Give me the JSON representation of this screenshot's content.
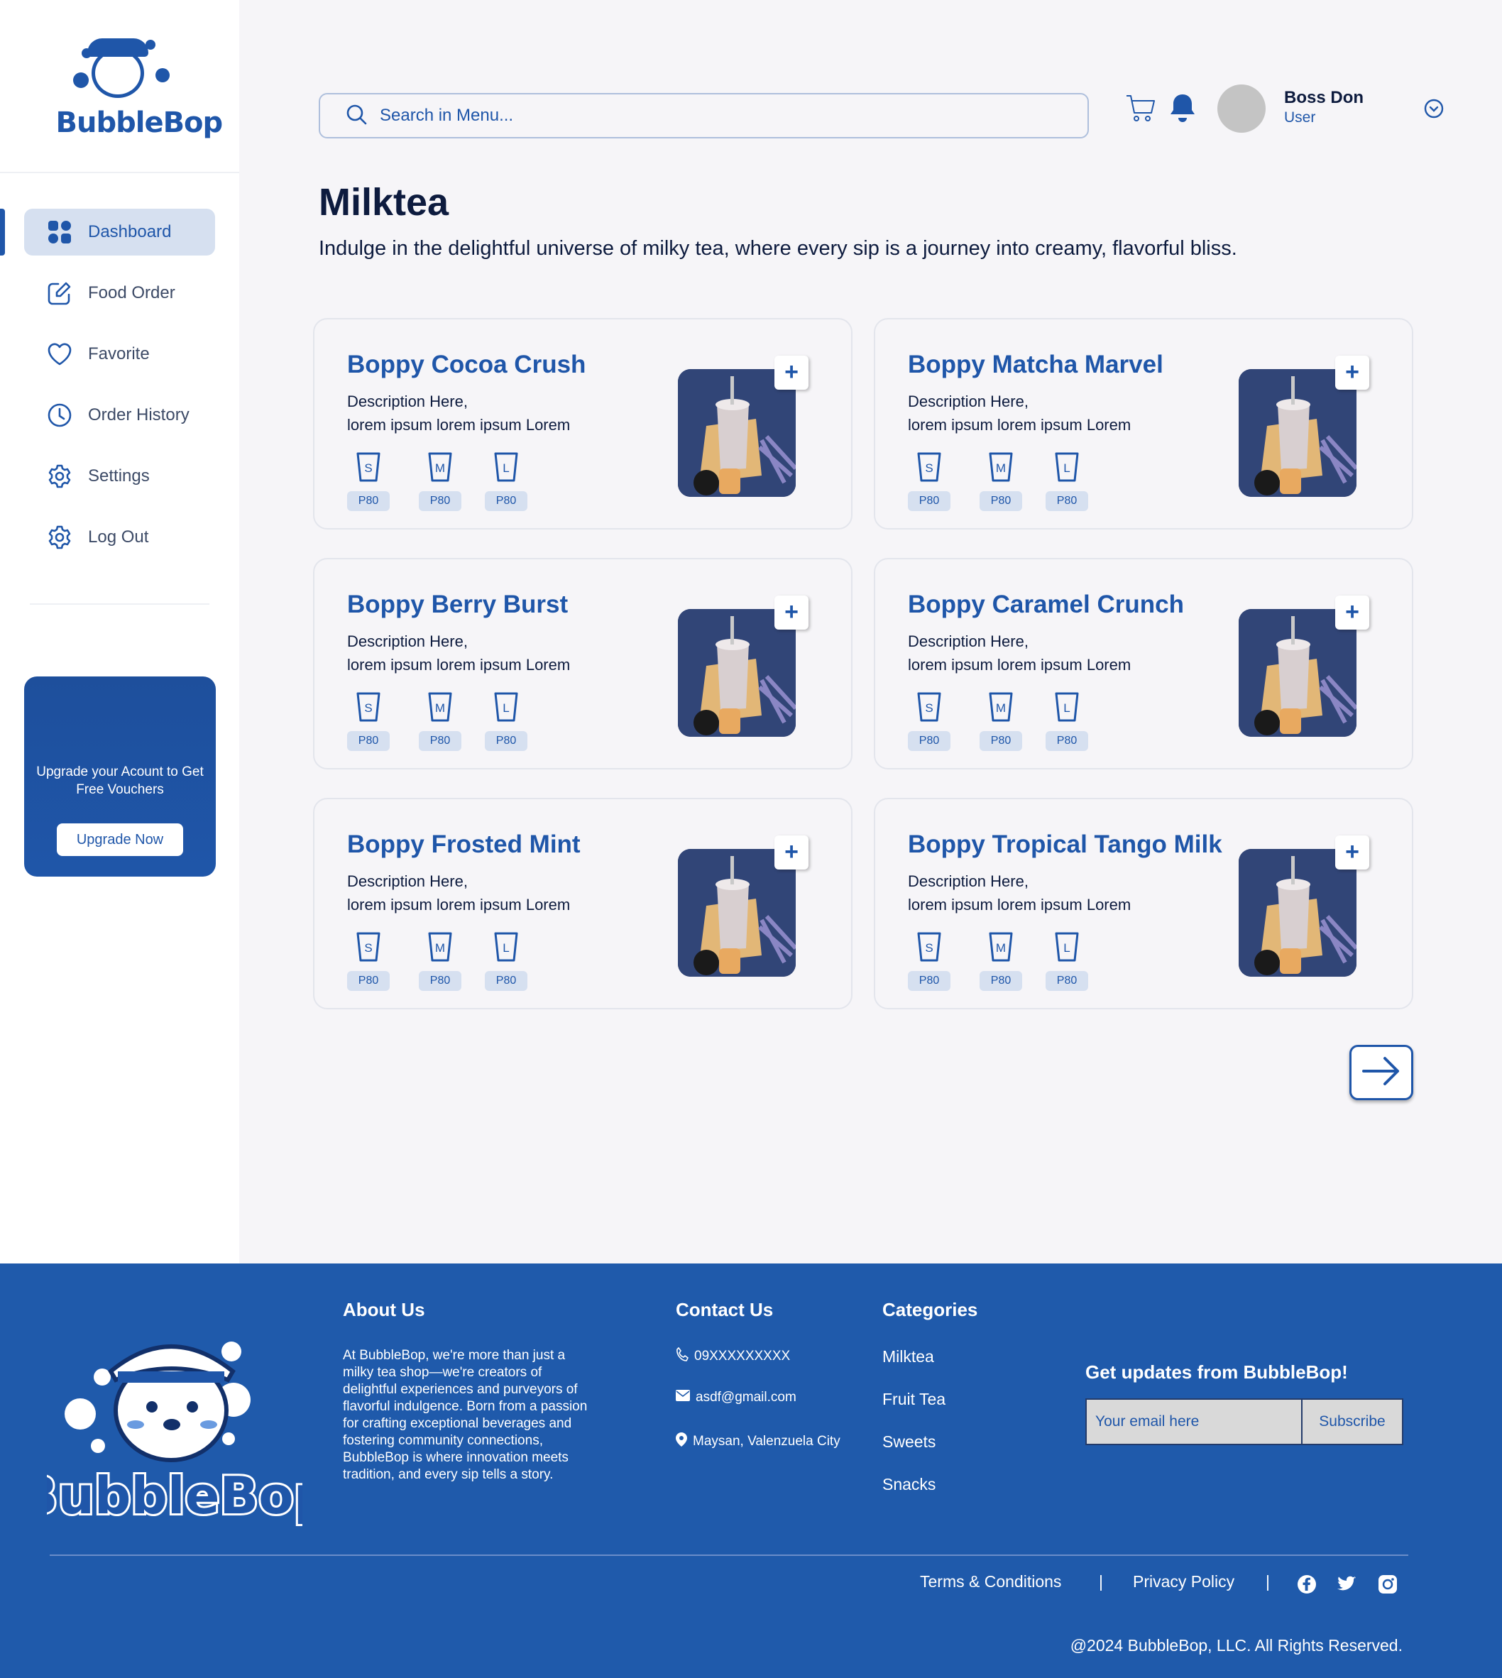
{
  "brand": {
    "name": "BubbleBop"
  },
  "sidebar": {
    "items": [
      {
        "label": "Dashboard",
        "icon": "grid-icon",
        "active": true
      },
      {
        "label": "Food Order",
        "icon": "edit-icon"
      },
      {
        "label": "Favorite",
        "icon": "heart-icon"
      },
      {
        "label": "Order History",
        "icon": "clock-icon"
      },
      {
        "label": "Settings",
        "icon": "gear-icon"
      },
      {
        "label": "Log Out",
        "icon": "gear-icon"
      }
    ],
    "upgrade": {
      "text": "Upgrade your Acount to Get Free Vouchers",
      "button": "Upgrade Now"
    }
  },
  "header": {
    "search_placeholder": "Search in Menu...",
    "user": {
      "name": "Boss Don",
      "role": "User"
    }
  },
  "page": {
    "title": "Milktea",
    "subtitle": "Indulge in the delightful universe of milky tea, where every sip is a journey into creamy, flavorful bliss."
  },
  "products": [
    {
      "name": "Boppy Cocoa Crush",
      "desc1": "Description Here,",
      "desc2": "lorem ipsum lorem ipsum Lorem",
      "sizes": [
        {
          "size": "S",
          "price": "P80"
        },
        {
          "size": "M",
          "price": "P80"
        },
        {
          "size": "L",
          "price": "P80"
        }
      ]
    },
    {
      "name": "Boppy Matcha Marvel",
      "desc1": "Description Here,",
      "desc2": "lorem ipsum lorem ipsum Lorem",
      "sizes": [
        {
          "size": "S",
          "price": "P80"
        },
        {
          "size": "M",
          "price": "P80"
        },
        {
          "size": "L",
          "price": "P80"
        }
      ]
    },
    {
      "name": "Boppy Berry Burst",
      "desc1": "Description Here,",
      "desc2": "lorem ipsum lorem ipsum Lorem",
      "sizes": [
        {
          "size": "S",
          "price": "P80"
        },
        {
          "size": "M",
          "price": "P80"
        },
        {
          "size": "L",
          "price": "P80"
        }
      ]
    },
    {
      "name": "Boppy Caramel Crunch",
      "desc1": "Description Here,",
      "desc2": "lorem ipsum lorem ipsum Lorem",
      "sizes": [
        {
          "size": "S",
          "price": "P80"
        },
        {
          "size": "M",
          "price": "P80"
        },
        {
          "size": "L",
          "price": "P80"
        }
      ]
    },
    {
      "name": "Boppy Frosted Mint",
      "desc1": "Description Here,",
      "desc2": "lorem ipsum lorem ipsum Lorem",
      "sizes": [
        {
          "size": "S",
          "price": "P80"
        },
        {
          "size": "M",
          "price": "P80"
        },
        {
          "size": "L",
          "price": "P80"
        }
      ]
    },
    {
      "name": "Boppy Tropical Tango Milk",
      "desc1": "Description Here,",
      "desc2": "lorem ipsum lorem ipsum Lorem",
      "sizes": [
        {
          "size": "S",
          "price": "P80"
        },
        {
          "size": "M",
          "price": "P80"
        },
        {
          "size": "L",
          "price": "P80"
        }
      ]
    }
  ],
  "footer": {
    "about": {
      "heading": "About Us",
      "text": "At BubbleBop, we're more than just a milky tea shop—we're creators of delightful experiences and purveyors of flavorful indulgence. Born from a passion for crafting exceptional beverages and fostering community connections, BubbleBop is where innovation meets tradition, and every sip tells a story."
    },
    "contact": {
      "heading": "Contact Us",
      "phone": "09XXXXXXXXX",
      "email": "asdf@gmail.com",
      "address": "Maysan, Valenzuela City"
    },
    "categories": {
      "heading": "Categories",
      "items": [
        "Milktea",
        "Fruit Tea",
        "Sweets",
        "Snacks"
      ]
    },
    "newsletter": {
      "heading": "Get updates from BubbleBop!",
      "placeholder": "Your email here",
      "button": "Subscribe"
    },
    "links": {
      "terms": "Terms & Conditions",
      "sep": "|",
      "privacy": "Privacy Policy"
    },
    "copyright": "@2024 BubbleBop, LLC. All Rights Reserved."
  },
  "colors": {
    "primary": "#1f56a9",
    "footer_bg": "#1f5aab",
    "page_bg": "#f6f5f8",
    "badge_bg": "#d6e0f0"
  }
}
